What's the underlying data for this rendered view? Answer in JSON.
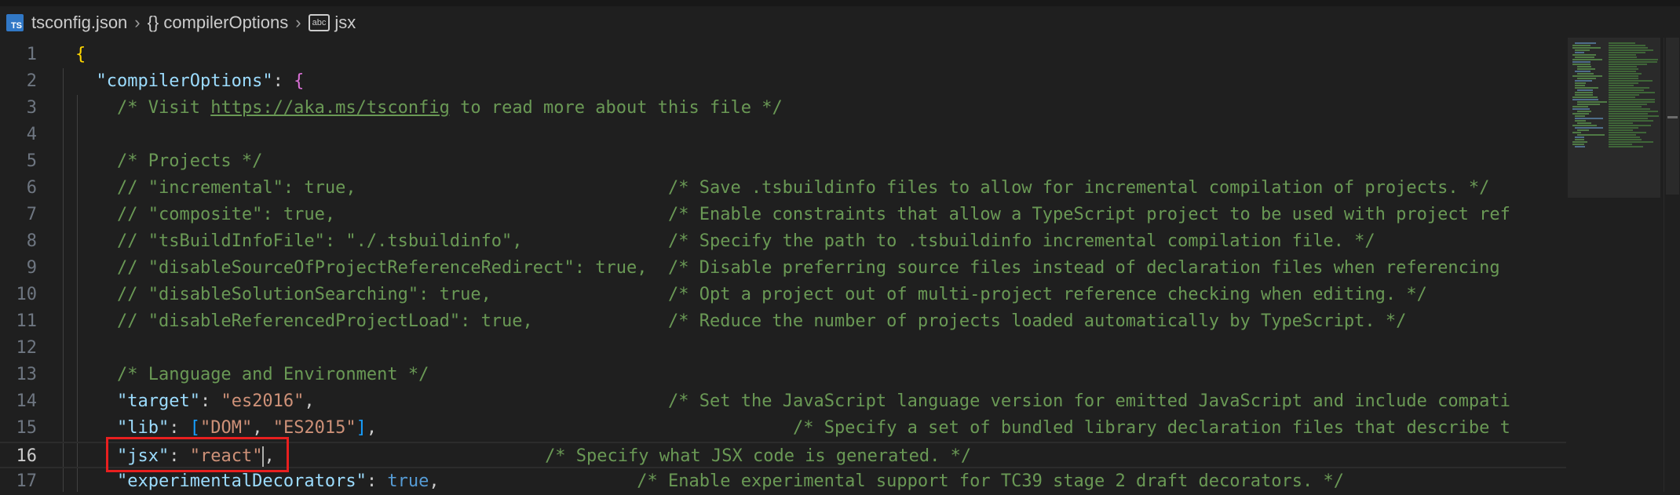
{
  "breadcrumb": {
    "file_icon": "typescript-file-icon",
    "file": "tsconfig.json",
    "object_icon": "braces-icon",
    "object": "compilerOptions",
    "property_icon": "string-abc-icon",
    "property": "jsx"
  },
  "colors": {
    "background": "#1f1f1f",
    "comment": "#6a9955",
    "key": "#9cdcfe",
    "string": "#ce9178",
    "keyword": "#569cd6",
    "highlight_box": "#e81f1f"
  },
  "editor": {
    "current_line": 16,
    "lines": [
      {
        "n": "1",
        "tokens": [
          {
            "t": "{",
            "c": "c-b1"
          }
        ]
      },
      {
        "n": "2",
        "tokens": [
          {
            "t": "  "
          },
          {
            "t": "\"compilerOptions\"",
            "c": "c-key"
          },
          {
            "t": ": "
          },
          {
            "t": "{",
            "c": "c-b2"
          }
        ]
      },
      {
        "n": "3",
        "tokens": [
          {
            "t": "    "
          },
          {
            "t": "/* Visit ",
            "c": "c-cmt"
          },
          {
            "t": "https://aka.ms/tsconfig",
            "c": "c-cmt c-link"
          },
          {
            "t": " to read more about this file */",
            "c": "c-cmt"
          }
        ]
      },
      {
        "n": "4",
        "tokens": []
      },
      {
        "n": "5",
        "tokens": [
          {
            "t": "    "
          },
          {
            "t": "/* Projects */",
            "c": "c-cmt"
          }
        ]
      },
      {
        "n": "6",
        "tokens": [
          {
            "t": "    "
          },
          {
            "t": "// \"incremental\": true,                              /* Save .tsbuildinfo files to allow for incremental compilation of projects. */",
            "c": "c-cmt"
          }
        ]
      },
      {
        "n": "7",
        "tokens": [
          {
            "t": "    "
          },
          {
            "t": "// \"composite\": true,                                /* Enable constraints that allow a TypeScript project to be used with project ref",
            "c": "c-cmt"
          }
        ]
      },
      {
        "n": "8",
        "tokens": [
          {
            "t": "    "
          },
          {
            "t": "// \"tsBuildInfoFile\": \"./.tsbuildinfo\",              /* Specify the path to .tsbuildinfo incremental compilation file. */",
            "c": "c-cmt"
          }
        ]
      },
      {
        "n": "9",
        "tokens": [
          {
            "t": "    "
          },
          {
            "t": "// \"disableSourceOfProjectReferenceRedirect\": true,  /* Disable preferring source files instead of declaration files when referencing",
            "c": "c-cmt"
          }
        ]
      },
      {
        "n": "10",
        "tokens": [
          {
            "t": "    "
          },
          {
            "t": "// \"disableSolutionSearching\": true,                 /* Opt a project out of multi-project reference checking when editing. */",
            "c": "c-cmt"
          }
        ]
      },
      {
        "n": "11",
        "tokens": [
          {
            "t": "    "
          },
          {
            "t": "// \"disableReferencedProjectLoad\": true,             /* Reduce the number of projects loaded automatically by TypeScript. */",
            "c": "c-cmt"
          }
        ]
      },
      {
        "n": "12",
        "tokens": []
      },
      {
        "n": "13",
        "tokens": [
          {
            "t": "    "
          },
          {
            "t": "/* Language and Environment */",
            "c": "c-cmt"
          }
        ]
      },
      {
        "n": "14",
        "tokens": [
          {
            "t": "    "
          },
          {
            "t": "\"target\"",
            "c": "c-key"
          },
          {
            "t": ": "
          },
          {
            "t": "\"es2016\"",
            "c": "c-str"
          },
          {
            "t": ",                                  "
          },
          {
            "t": "/* Set the JavaScript language version for emitted JavaScript and include compati",
            "c": "c-cmt"
          }
        ]
      },
      {
        "n": "15",
        "tokens": [
          {
            "t": "    "
          },
          {
            "t": "\"lib\"",
            "c": "c-key"
          },
          {
            "t": ": "
          },
          {
            "t": "[",
            "c": "c-b3"
          },
          {
            "t": "\"DOM\"",
            "c": "c-str"
          },
          {
            "t": ", "
          },
          {
            "t": "\"ES2015\"",
            "c": "c-str"
          },
          {
            "t": "]",
            "c": "c-b3"
          },
          {
            "t": ",                                        "
          },
          {
            "t": "/* Specify a set of bundled library declaration files that describe t",
            "c": "c-cmt"
          }
        ]
      },
      {
        "n": "16",
        "tokens": [
          {
            "t": "    "
          },
          {
            "t": "\"jsx\"",
            "c": "c-key"
          },
          {
            "t": ": "
          },
          {
            "t": "\"react\"",
            "c": "c-str"
          },
          {
            "cursor": true
          },
          {
            "t": ",                          "
          },
          {
            "t": "/* Specify what JSX code is generated. */",
            "c": "c-cmt"
          }
        ]
      },
      {
        "n": "17",
        "tokens": [
          {
            "t": "    "
          },
          {
            "t": "\"experimentalDecorators\"",
            "c": "c-key"
          },
          {
            "t": ": "
          },
          {
            "t": "true",
            "c": "c-bool"
          },
          {
            "t": ",                   "
          },
          {
            "t": "/* Enable experimental support for TC39 stage 2 draft decorators. */",
            "c": "c-cmt"
          }
        ]
      }
    ]
  }
}
